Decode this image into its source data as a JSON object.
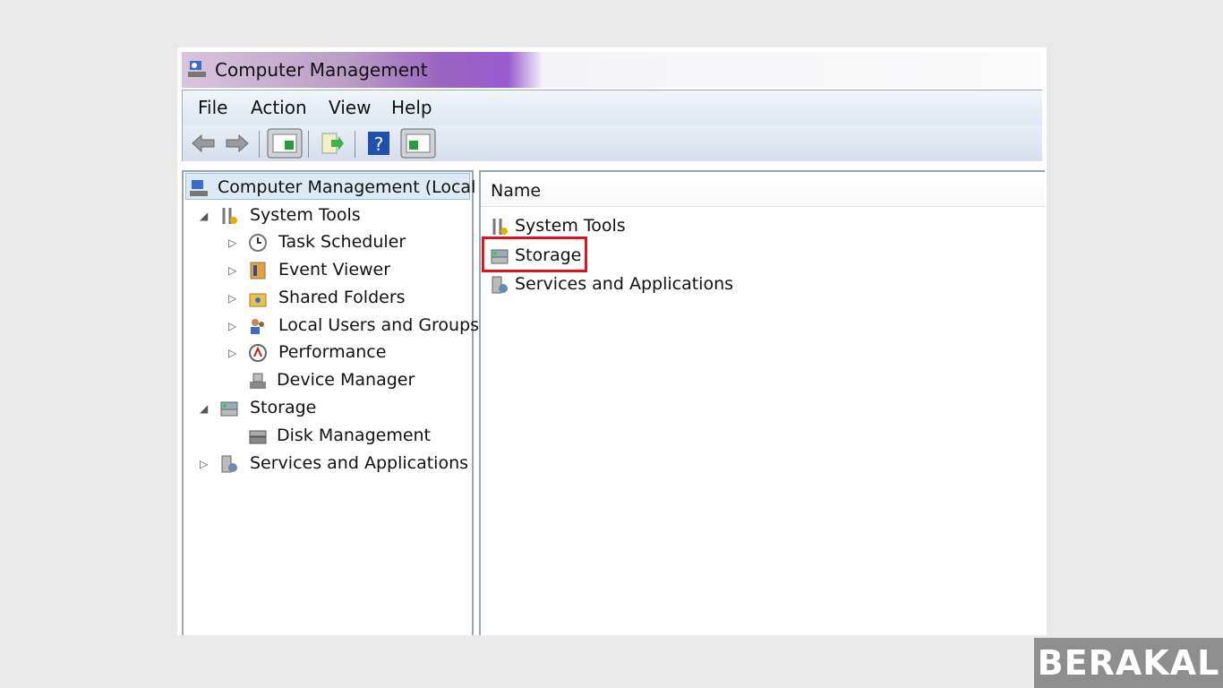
{
  "window": {
    "title": "Computer Management"
  },
  "menu": [
    "File",
    "Action",
    "View",
    "Help"
  ],
  "toolbar": [
    "back-icon",
    "forward-icon",
    "show-hide-console-tree-icon",
    "export-list-icon",
    "help-icon",
    "show-hide-action-pane-icon"
  ],
  "tree": [
    {
      "label": "Computer Management (Local",
      "level": 0,
      "expander": ""
    },
    {
      "label": "System Tools",
      "level": 1,
      "expander": "expanded"
    },
    {
      "label": "Task Scheduler",
      "level": 2,
      "expander": "collapsed"
    },
    {
      "label": "Event Viewer",
      "level": 2,
      "expander": "collapsed"
    },
    {
      "label": "Shared Folders",
      "level": 2,
      "expander": "collapsed"
    },
    {
      "label": "Local Users and Groups",
      "level": 2,
      "expander": "collapsed"
    },
    {
      "label": "Performance",
      "level": 2,
      "expander": "collapsed"
    },
    {
      "label": "Device Manager",
      "level": 2,
      "expander": ""
    },
    {
      "label": "Storage",
      "level": 1,
      "expander": "expanded"
    },
    {
      "label": "Disk Management",
      "level": 2,
      "expander": ""
    },
    {
      "label": "Services and Applications",
      "level": 1,
      "expander": "collapsed"
    }
  ],
  "list": {
    "column": "Name",
    "items": [
      "System Tools",
      "Storage",
      "Services and Applications"
    ],
    "highlighted": "Storage",
    "highlight_color": "#e0141e"
  },
  "watermark": "BERAKAL"
}
